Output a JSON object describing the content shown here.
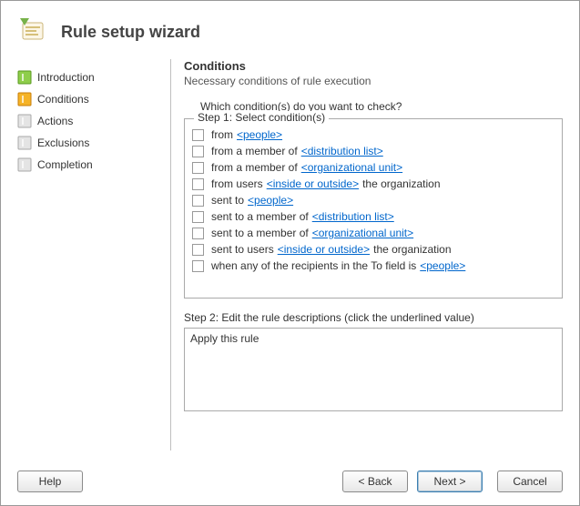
{
  "header": {
    "title": "Rule setup wizard"
  },
  "sidebar": {
    "items": [
      {
        "label": "Introduction",
        "icon": "green"
      },
      {
        "label": "Conditions",
        "icon": "orange"
      },
      {
        "label": "Actions",
        "icon": "gray"
      },
      {
        "label": "Exclusions",
        "icon": "gray"
      },
      {
        "label": "Completion",
        "icon": "gray"
      }
    ]
  },
  "main": {
    "title": "Conditions",
    "subtitle": "Necessary conditions of rule execution",
    "prompt": "Which condition(s) do you want to check?",
    "step1_label": "Step 1: Select condition(s)",
    "conditions": [
      {
        "parts": [
          {
            "t": "from "
          },
          {
            "t": "<people>",
            "link": true
          }
        ]
      },
      {
        "parts": [
          {
            "t": "from a member of "
          },
          {
            "t": "<distribution list>",
            "link": true
          }
        ]
      },
      {
        "parts": [
          {
            "t": "from a member of "
          },
          {
            "t": "<organizational unit>",
            "link": true
          }
        ]
      },
      {
        "parts": [
          {
            "t": "from users "
          },
          {
            "t": "<inside or outside>",
            "link": true
          },
          {
            "t": "  the organization"
          }
        ]
      },
      {
        "parts": [
          {
            "t": "sent to "
          },
          {
            "t": "<people>",
            "link": true
          }
        ]
      },
      {
        "parts": [
          {
            "t": "sent to a member of "
          },
          {
            "t": "<distribution list>",
            "link": true
          }
        ]
      },
      {
        "parts": [
          {
            "t": "sent to a member of "
          },
          {
            "t": "<organizational unit>",
            "link": true
          }
        ]
      },
      {
        "parts": [
          {
            "t": "sent to users "
          },
          {
            "t": "<inside or outside>",
            "link": true
          },
          {
            "t": "  the organization"
          }
        ]
      },
      {
        "parts": [
          {
            "t": "when any of the recipients in the To field is "
          },
          {
            "t": "<people>",
            "link": true
          }
        ]
      }
    ],
    "step2_label": "Step 2: Edit the rule descriptions (click the underlined value)",
    "description": "Apply this rule"
  },
  "footer": {
    "help": "Help",
    "back": "< Back",
    "next": "Next >",
    "cancel": "Cancel"
  }
}
